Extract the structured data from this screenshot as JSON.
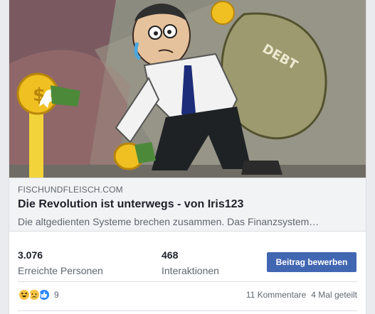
{
  "link_preview": {
    "domain": "FISCHUNDFLEISCH.COM",
    "title": "Die Revolution ist unterwegs - von Iris123",
    "description": "Die altgedienten Systeme brechen zusammen. Das Finanzsystem…",
    "image_text": "DEBT"
  },
  "stats": {
    "reach": {
      "value": "3.076",
      "label": "Erreichte Personen"
    },
    "engagement": {
      "value": "468",
      "label": "Interaktionen"
    }
  },
  "promote_button": {
    "label": "Beitrag bewerben"
  },
  "reactions": {
    "icons": [
      "haha-icon",
      "sad-icon",
      "like-icon"
    ],
    "count": "9"
  },
  "footer": {
    "comments": "11 Kommentare",
    "shares": "4 Mal geteilt"
  },
  "colors": {
    "accent": "#4267b2",
    "preview_background": "#f2f3f5",
    "secondary_text": "#606770"
  }
}
